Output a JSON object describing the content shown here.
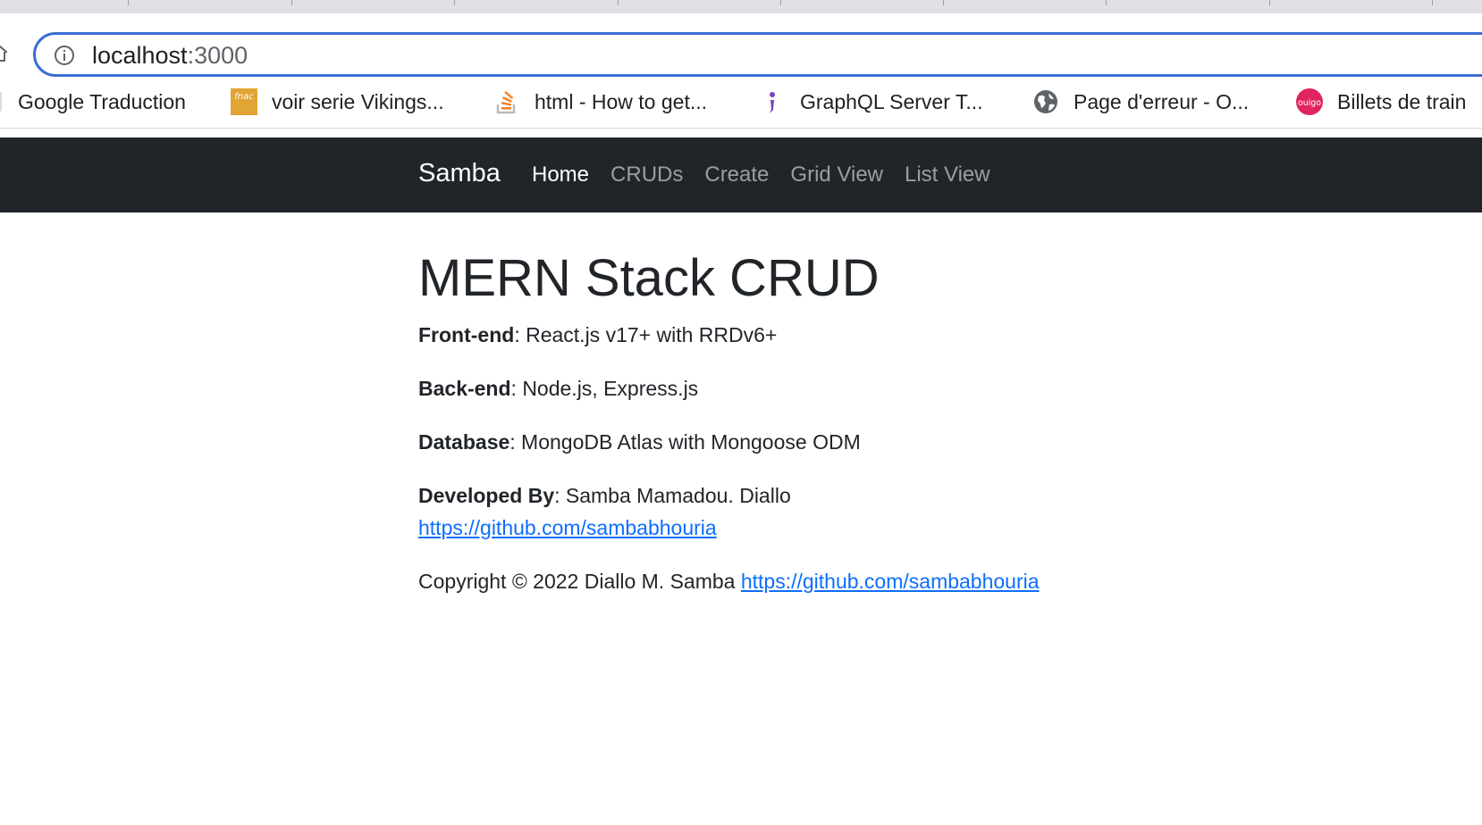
{
  "browser": {
    "url_host": "localhost",
    "url_port": ":3000",
    "bookmarks": [
      {
        "label": "Google Traduction",
        "icon": "translate-icon"
      },
      {
        "label": "voir serie Vikings...",
        "icon": "fnac-icon"
      },
      {
        "label": "html - How to get...",
        "icon": "stackoverflow-icon"
      },
      {
        "label": "GraphQL Server T...",
        "icon": "graphql-icon"
      },
      {
        "label": "Page d'erreur - O...",
        "icon": "globe-icon"
      },
      {
        "label": "Billets de train",
        "icon": "ouigo-icon"
      }
    ],
    "fnac_icon_text": "fnac",
    "ouigo_icon_text": "ouigo",
    "colors": {
      "omnibox_border": "#3a6fd3",
      "fnac": "#e1a534",
      "stackoverflow": "#f48024",
      "graphql": "#7b3fbf",
      "ouigo": "#e0245e"
    }
  },
  "navbar": {
    "brand": "Samba",
    "links": [
      {
        "label": "Home",
        "active": true
      },
      {
        "label": "CRUDs",
        "active": false
      },
      {
        "label": "Create",
        "active": false
      },
      {
        "label": "Grid View",
        "active": false
      },
      {
        "label": "List View",
        "active": false
      }
    ],
    "colors": {
      "background": "#212529"
    }
  },
  "main": {
    "title": "MERN Stack CRUD",
    "frontend_label": "Front-end",
    "frontend_value": ": React.js v17+ with RRDv6+",
    "backend_label": "Back-end",
    "backend_value": ": Node.js, Express.js",
    "database_label": "Database",
    "database_value": ": MongoDB Atlas with Mongoose ODM",
    "developer_label": "Developed By",
    "developer_value": ": Samba Mamadou. Diallo",
    "developer_link": "https://github.com/sambabhouria",
    "copyright_text": "Copyright © 2022 Diallo M. Samba ",
    "copyright_link": "https://github.com/sambabhouria",
    "colors": {
      "link": "#0d6efd"
    }
  }
}
